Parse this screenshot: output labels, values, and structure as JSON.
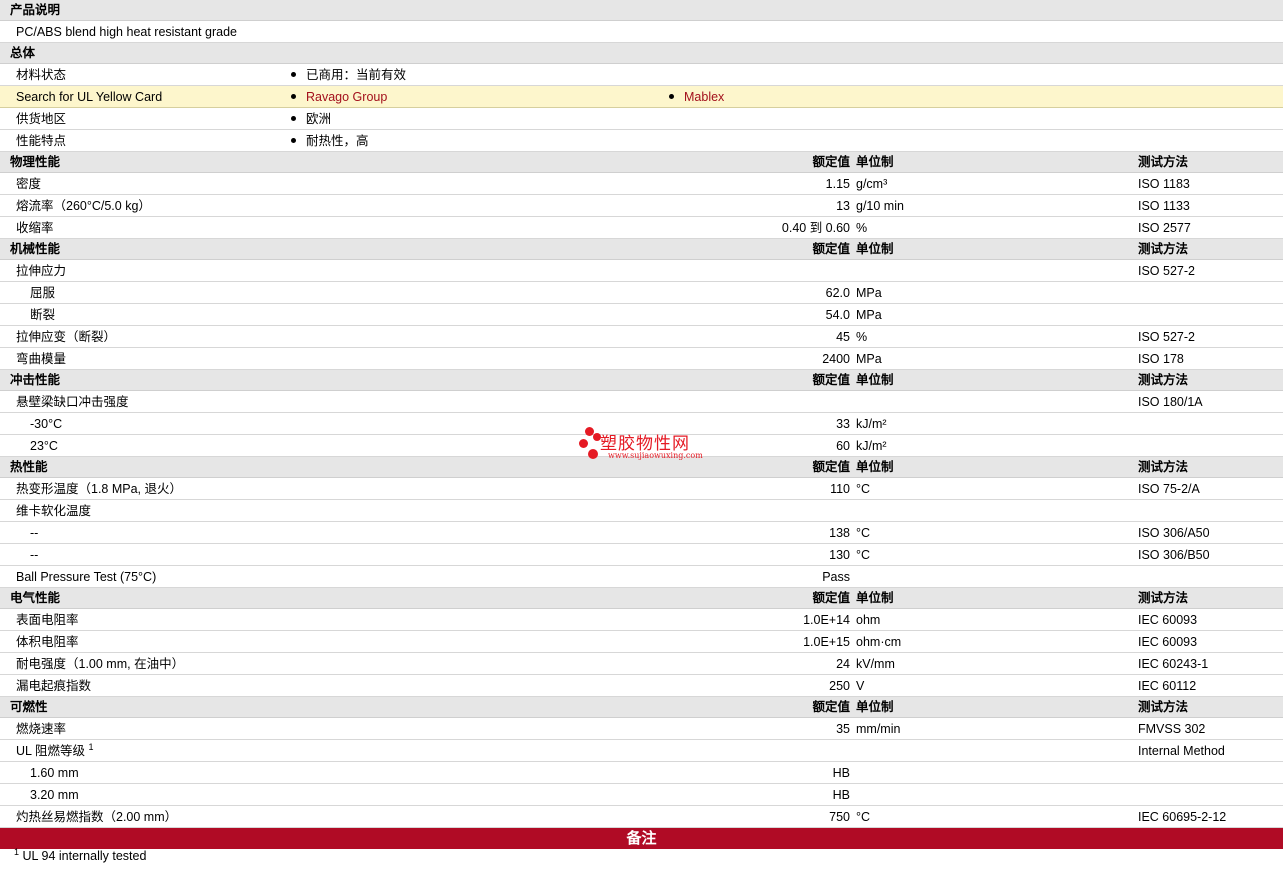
{
  "desc": {
    "header": "产品说明",
    "text": "PC/ABS blend high heat resistant grade"
  },
  "general": {
    "header": "总体",
    "rows": [
      {
        "label": "材料状态",
        "v1": "已商用：当前有效",
        "v2": ""
      },
      {
        "label": "Search for UL Yellow Card",
        "v1": "Ravago Group",
        "v2": "Mablex"
      },
      {
        "label": "供货地区",
        "v1": "欧洲",
        "v2": ""
      },
      {
        "label": "性能特点",
        "v1": "耐热性，高",
        "v2": ""
      }
    ]
  },
  "col_headers": {
    "value": "额定值",
    "unit": "单位制",
    "test": "测试方法"
  },
  "sections": [
    {
      "title": "物理性能",
      "rows": [
        {
          "label": "密度",
          "value": "1.15",
          "unit": "g/cm³",
          "test": "ISO 1183"
        },
        {
          "label": "熔流率（260°C/5.0 kg）",
          "value": "13",
          "unit": "g/10 min",
          "test": "ISO 1133"
        },
        {
          "label": "收缩率",
          "value": "0.40 到  0.60",
          "unit": "%",
          "test": "ISO 2577"
        }
      ]
    },
    {
      "title": "机械性能",
      "rows": [
        {
          "label": "拉伸应力",
          "value": "",
          "unit": "",
          "test": "ISO 527-2"
        },
        {
          "label": "屈服",
          "value": "62.0",
          "unit": "MPa",
          "test": "",
          "sub": true
        },
        {
          "label": "断裂",
          "value": "54.0",
          "unit": "MPa",
          "test": "",
          "sub": true
        },
        {
          "label": "拉伸应变（断裂）",
          "value": "45",
          "unit": "%",
          "test": "ISO 527-2"
        },
        {
          "label": "弯曲模量",
          "value": "2400",
          "unit": "MPa",
          "test": "ISO 178"
        }
      ]
    },
    {
      "title": "冲击性能",
      "rows": [
        {
          "label": "悬壁梁缺口冲击强度",
          "value": "",
          "unit": "",
          "test": "ISO 180/1A"
        },
        {
          "label": "-30°C",
          "value": "33",
          "unit": "kJ/m²",
          "test": "",
          "sub": true
        },
        {
          "label": "23°C",
          "value": "60",
          "unit": "kJ/m²",
          "test": "",
          "sub": true
        }
      ]
    },
    {
      "title": "热性能",
      "rows": [
        {
          "label": "热变形温度（1.8 MPa, 退火）",
          "value": "110",
          "unit": "°C",
          "test": "ISO 75-2/A"
        },
        {
          "label": "维卡软化温度",
          "value": "",
          "unit": "",
          "test": ""
        },
        {
          "label": "--",
          "value": "138",
          "unit": "°C",
          "test": "ISO 306/A50",
          "sub": true
        },
        {
          "label": "--",
          "value": "130",
          "unit": "°C",
          "test": "ISO 306/B50",
          "sub": true
        },
        {
          "label": "Ball Pressure Test (75°C)",
          "value": "Pass",
          "unit": "",
          "test": ""
        }
      ]
    },
    {
      "title": "电气性能",
      "rows": [
        {
          "label": "表面电阻率",
          "value": "1.0E+14",
          "unit": "ohm",
          "test": "IEC 60093"
        },
        {
          "label": "体积电阻率",
          "value": "1.0E+15",
          "unit": "ohm·cm",
          "test": "IEC 60093"
        },
        {
          "label": "耐电强度（1.00 mm, 在油中）",
          "value": "24",
          "unit": "kV/mm",
          "test": "IEC 60243-1"
        },
        {
          "label": "漏电起痕指数",
          "value": "250",
          "unit": "V",
          "test": "IEC 60112"
        }
      ]
    },
    {
      "title": "可燃性",
      "rows": [
        {
          "label": "燃烧速率",
          "value": "35",
          "unit": "mm/min",
          "test": "FMVSS 302"
        },
        {
          "label": "UL 阻燃等级",
          "sup": "1",
          "value": "",
          "unit": "",
          "test": "Internal Method"
        },
        {
          "label": "1.60 mm",
          "value": "HB",
          "unit": "",
          "test": "",
          "sub": true
        },
        {
          "label": "3.20 mm",
          "value": "HB",
          "unit": "",
          "test": "",
          "sub": true
        },
        {
          "label": "灼热丝易燃指数（2.00 mm）",
          "value": "750",
          "unit": "°C",
          "test": "IEC 60695-2-12"
        }
      ]
    }
  ],
  "notes": {
    "title": "备注",
    "items": [
      {
        "num": "1",
        "text": "UL 94 internally tested"
      }
    ]
  },
  "watermark": {
    "brand": "塑胶物性网",
    "url": "www.sujiaowuxing.com"
  },
  "colors": {
    "accent": "#b00b25",
    "link": "#a3101c",
    "highlight": "#fdf6cc"
  }
}
